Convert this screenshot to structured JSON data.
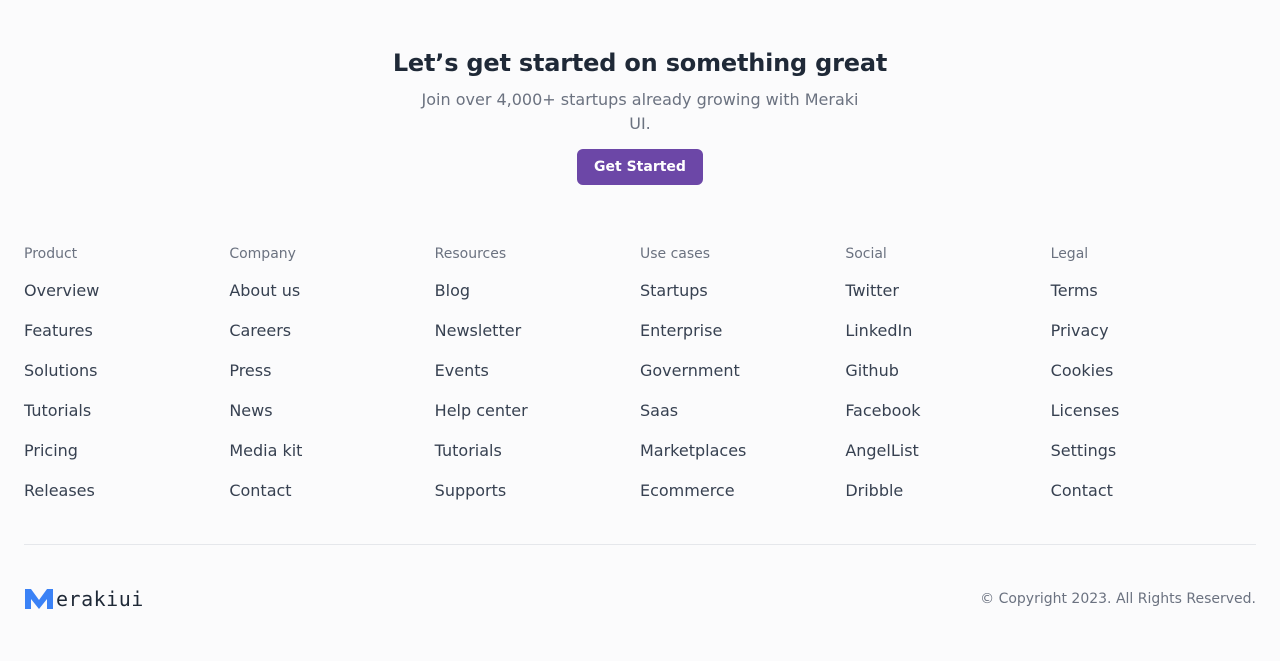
{
  "cta": {
    "title": "Let’s get started on something great",
    "subtitle": "Join over 4,000+ startups already growing with Meraki UI.",
    "button_label": "Get Started",
    "button_color": "#6c47a7"
  },
  "columns": [
    {
      "heading": "Product",
      "links": [
        "Overview",
        "Features",
        "Solutions",
        "Tutorials",
        "Pricing",
        "Releases"
      ]
    },
    {
      "heading": "Company",
      "links": [
        "About us",
        "Careers",
        "Press",
        "News",
        "Media kit",
        "Contact"
      ]
    },
    {
      "heading": "Resources",
      "links": [
        "Blog",
        "Newsletter",
        "Events",
        "Help center",
        "Tutorials",
        "Supports"
      ]
    },
    {
      "heading": "Use cases",
      "links": [
        "Startups",
        "Enterprise",
        "Government",
        "Saas",
        "Marketplaces",
        "Ecommerce"
      ]
    },
    {
      "heading": "Social",
      "links": [
        "Twitter",
        "LinkedIn",
        "Github",
        "Facebook",
        "AngelList",
        "Dribble"
      ]
    },
    {
      "heading": "Legal",
      "links": [
        "Terms",
        "Privacy",
        "Cookies",
        "Licenses",
        "Settings",
        "Contact"
      ]
    }
  ],
  "footer": {
    "logo_icon": "meraki-m-logo-icon",
    "logo_text": "erakiui",
    "logo_color": "#3b82f6",
    "copyright": "© Copyright 2023. All Rights Reserved."
  }
}
